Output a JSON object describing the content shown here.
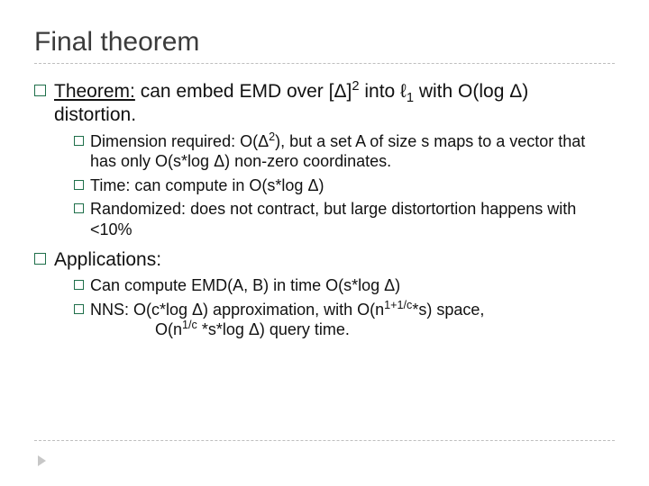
{
  "title": "Final theorem",
  "theorem": {
    "label": "Theorem:",
    "rest1": " can embed EMD over [Δ]",
    "sup1": "2",
    "rest2": " into ℓ",
    "sub1": "1",
    "rest3": " with O(log Δ) distortion."
  },
  "sub1": {
    "dim": {
      "label": "Dimension required:",
      "rest1": "  O(Δ",
      "sup": "2",
      "rest2": "), but a set A of size s maps to a vector that has only O(s*log Δ) non-zero coordinates."
    },
    "time": {
      "label": "Time:",
      "rest": " can compute in O(s*log Δ)"
    },
    "rand": {
      "label": "Randomized:",
      "rest": " does not contract, but large distortortion happens with <10%"
    }
  },
  "applications": {
    "label": "Applications:"
  },
  "sub2": {
    "can": {
      "label": "Can",
      "rest": " compute EMD(A, B) in time O(s*log Δ)"
    },
    "nns": {
      "label": "NNS:",
      "rest1": " O(c*log Δ) approximation, with O(n",
      "sup1": "1+1/c",
      "rest2": "*s) space,",
      "line2a": "O(n",
      "sup2": "1/c",
      "line2b": " *s*log Δ) query time."
    }
  }
}
